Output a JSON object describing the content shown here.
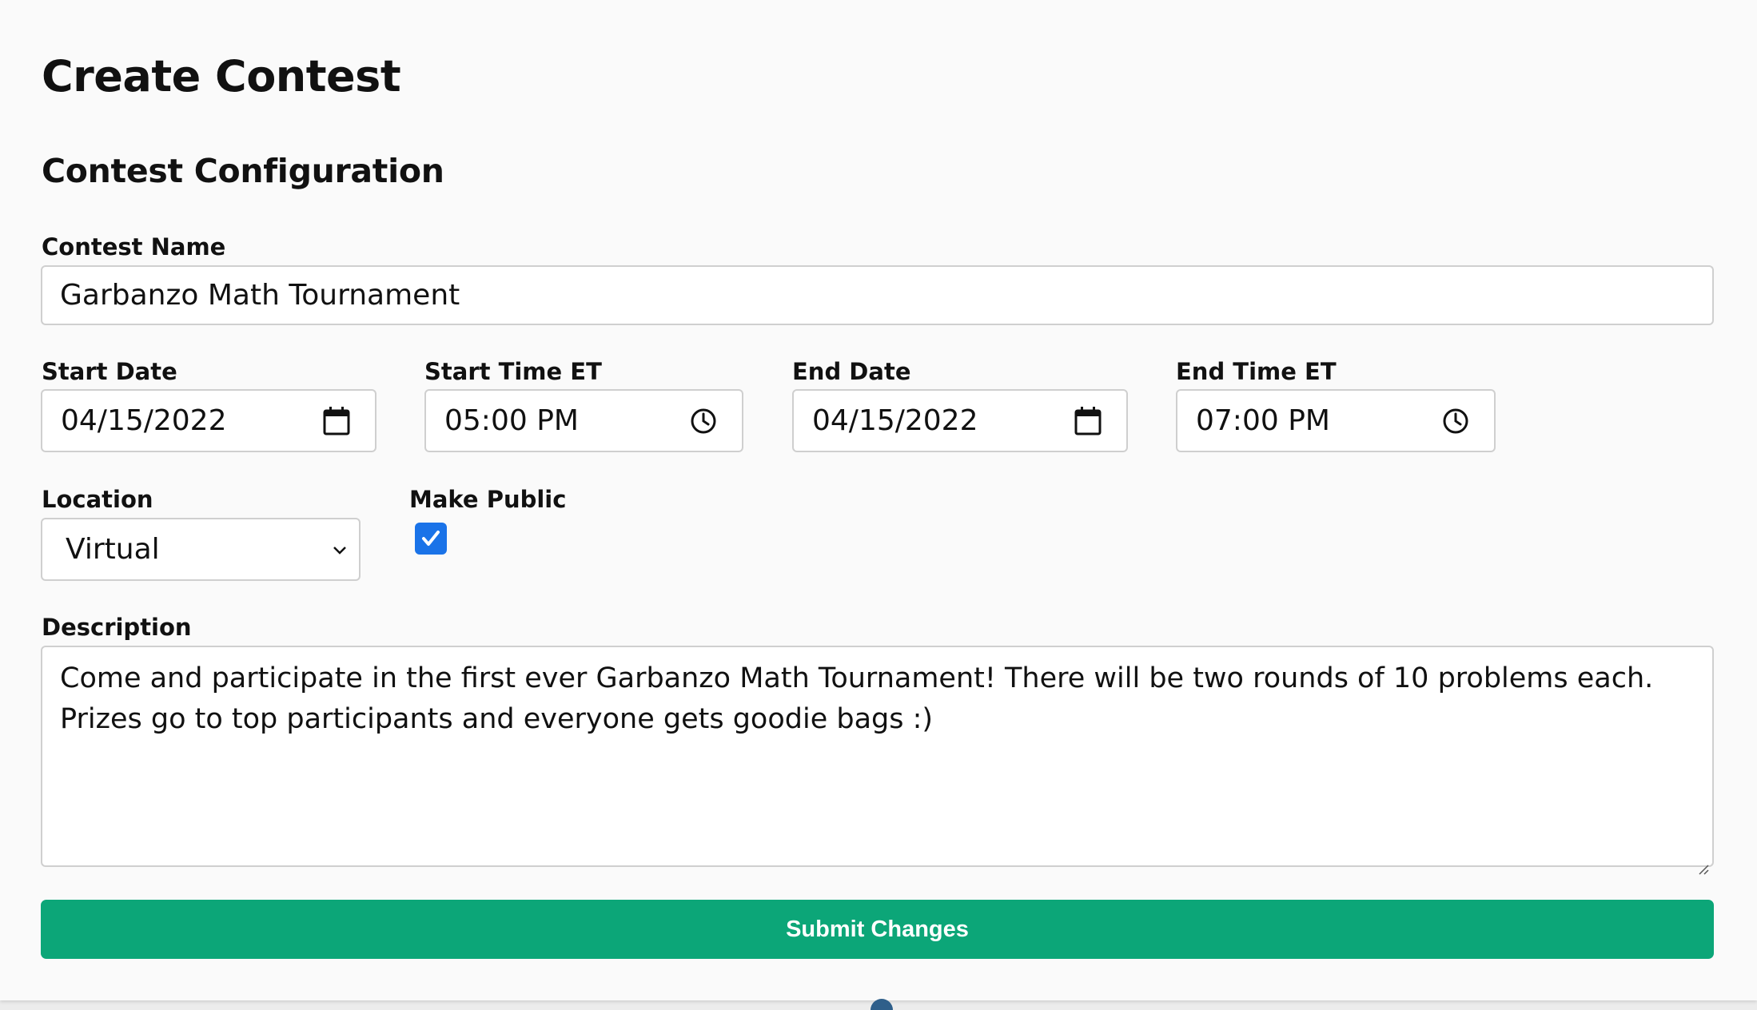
{
  "page": {
    "title": "Create Contest",
    "section_title": "Contest Configuration"
  },
  "form": {
    "contest_name": {
      "label": "Contest Name",
      "value": "Garbanzo Math Tournament"
    },
    "start_date": {
      "label": "Start Date",
      "value": "04/15/2022",
      "icon": "calendar-icon"
    },
    "start_time": {
      "label": "Start Time ET",
      "value": "05:00 PM",
      "icon": "clock-icon"
    },
    "end_date": {
      "label": "End Date",
      "value": "04/15/2022",
      "icon": "calendar-icon"
    },
    "end_time": {
      "label": "End Time ET",
      "value": "07:00 PM",
      "icon": "clock-icon"
    },
    "location": {
      "label": "Location",
      "value": "Virtual",
      "icon": "chevron-down-icon"
    },
    "make_public": {
      "label": "Make Public",
      "checked": true
    },
    "description": {
      "label": "Description",
      "value": "Come and participate in the first ever Garbanzo Math Tournament! There will be two rounds of 10 problems each. Prizes go to top participants and everyone gets goodie bags :)"
    },
    "submit_label": "Submit Changes"
  },
  "colors": {
    "submit_bg": "#0ca678",
    "checkbox_bg": "#1a73e8",
    "page_bg": "#fafafa"
  }
}
